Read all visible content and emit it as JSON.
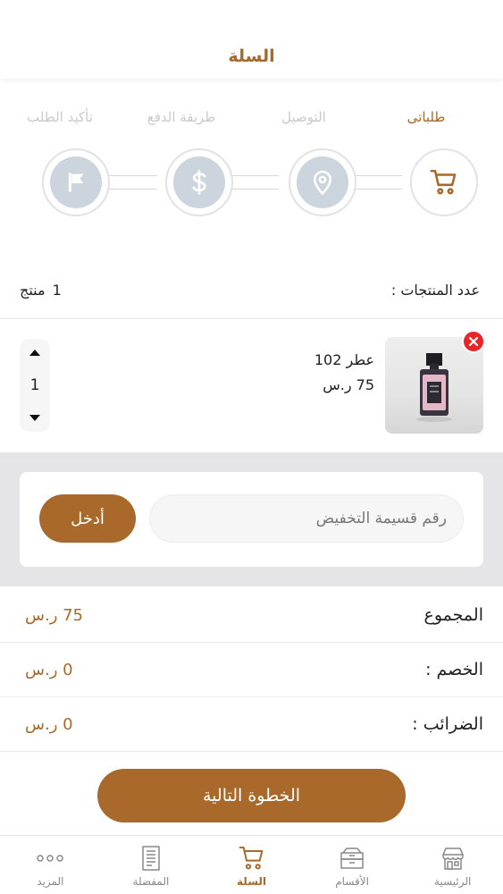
{
  "header": {
    "title": "السلة"
  },
  "steps": [
    {
      "label": "طلباتى",
      "icon": "cart-icon",
      "active": true
    },
    {
      "label": "التوصيل",
      "icon": "location-pin-icon",
      "active": false
    },
    {
      "label": "طريقة الدفع",
      "icon": "dollar-icon",
      "active": false
    },
    {
      "label": "تأكيد الطلب",
      "icon": "flag-icon",
      "active": false
    }
  ],
  "products_count": {
    "label": "عدد المنتجات :",
    "value": "1",
    "unit": "منتج"
  },
  "cart_item": {
    "name": "عطر 102",
    "price": "75 ر.س",
    "quantity": "1"
  },
  "coupon": {
    "placeholder": "رقم قسيمة التخفيض",
    "button_label": "أدخل"
  },
  "summary": [
    {
      "label": "المجموع",
      "value": "75 ر.س"
    },
    {
      "label": "الخصم :",
      "value": "0 ر.س"
    },
    {
      "label": "الضرائب :",
      "value": "0 ر.س"
    }
  ],
  "next_button": {
    "label": "الخطوة التالية"
  },
  "bottom_nav": [
    {
      "label": "الرئيسية",
      "icon": "store-icon",
      "active": false
    },
    {
      "label": "الأقسام",
      "icon": "box-icon",
      "active": false
    },
    {
      "label": "السلة",
      "icon": "cart-icon",
      "active": true
    },
    {
      "label": "المفضلة",
      "icon": "document-icon",
      "active": false
    },
    {
      "label": "المزيد",
      "icon": "more-dots-icon",
      "active": false
    }
  ],
  "colors": {
    "accent": "#a8692a",
    "inactive_step": "#ccd4dd",
    "remove": "#e8262a",
    "coupon_bg": "#e5e4e6"
  }
}
